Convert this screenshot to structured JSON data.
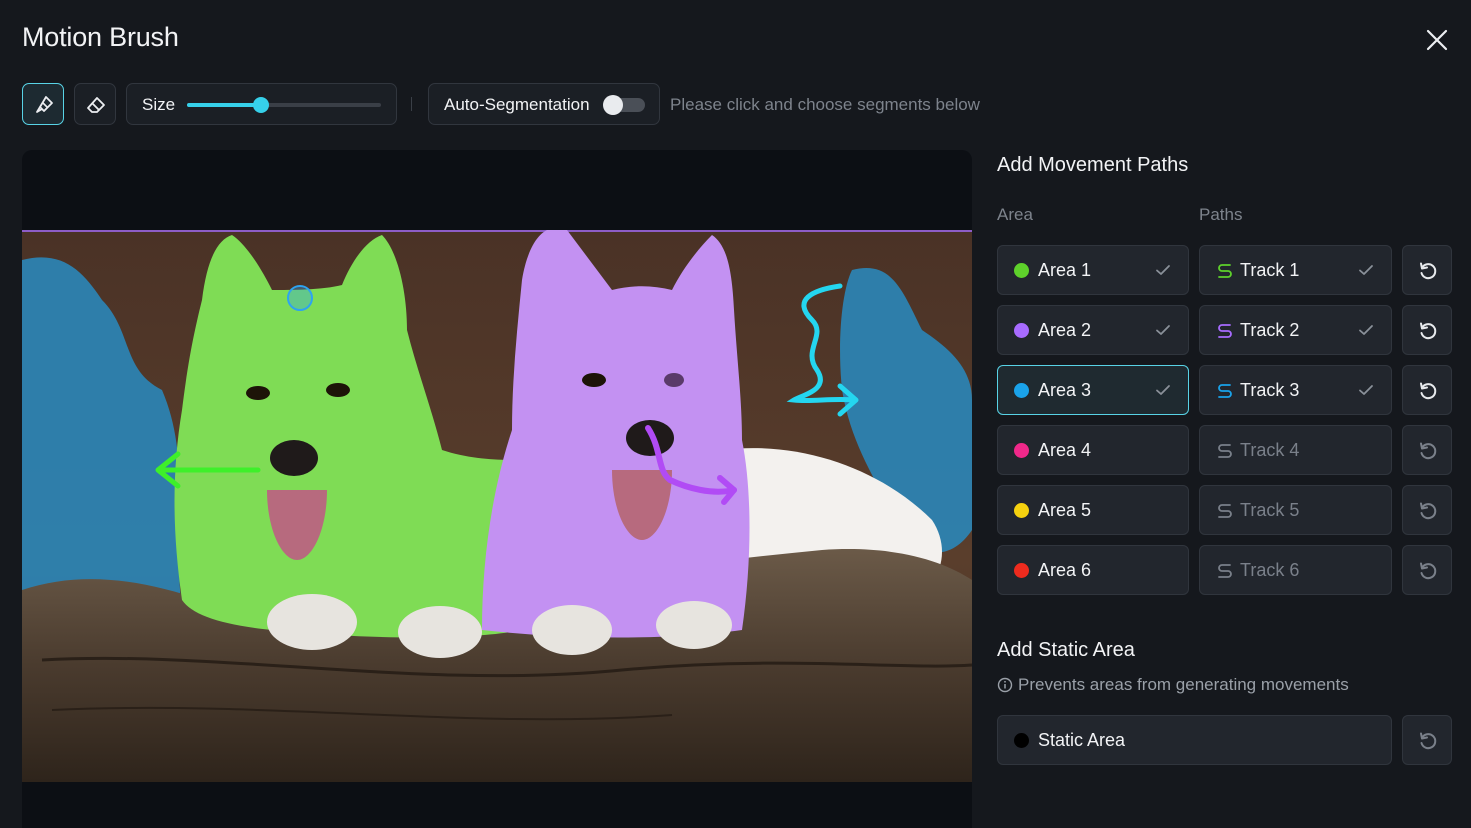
{
  "title": "Motion Brush",
  "toolbar": {
    "size_label": "Size",
    "size_value_percent": 38,
    "autoseg_label": "Auto-Segmentation",
    "autoseg_enabled": false,
    "hint": "Please click and choose segments below"
  },
  "panel": {
    "movement_title": "Add Movement Paths",
    "area_col": "Area",
    "paths_col": "Paths",
    "rows": [
      {
        "area": "Area 1",
        "area_color": "#5ed12b",
        "track": "Track 1",
        "track_color": "#5ed12b",
        "done": true,
        "selected": false
      },
      {
        "area": "Area 2",
        "area_color": "#a86bff",
        "track": "Track 2",
        "track_color": "#a86bff",
        "done": true,
        "selected": false
      },
      {
        "area": "Area 3",
        "area_color": "#1aa3ea",
        "track": "Track 3",
        "track_color": "#1aa3ea",
        "done": true,
        "selected": true
      },
      {
        "area": "Area 4",
        "area_color": "#f0288a",
        "track": "Track 4",
        "track_color": "#7a808a",
        "done": false,
        "selected": false
      },
      {
        "area": "Area 5",
        "area_color": "#f5d10f",
        "track": "Track 5",
        "track_color": "#7a808a",
        "done": false,
        "selected": false
      },
      {
        "area": "Area 6",
        "area_color": "#ee2b1e",
        "track": "Track 6",
        "track_color": "#7a808a",
        "done": false,
        "selected": false
      }
    ],
    "static_title": "Add Static Area",
    "static_info": "Prevents areas from generating movements",
    "static_label": "Static Area",
    "static_color": "#000000"
  },
  "icons": {
    "brush": "brush-icon",
    "eraser": "eraser-icon",
    "close": "close-icon",
    "check": "check-icon",
    "track": "s-path-icon",
    "reset": "reset-icon",
    "info": "info-icon"
  }
}
